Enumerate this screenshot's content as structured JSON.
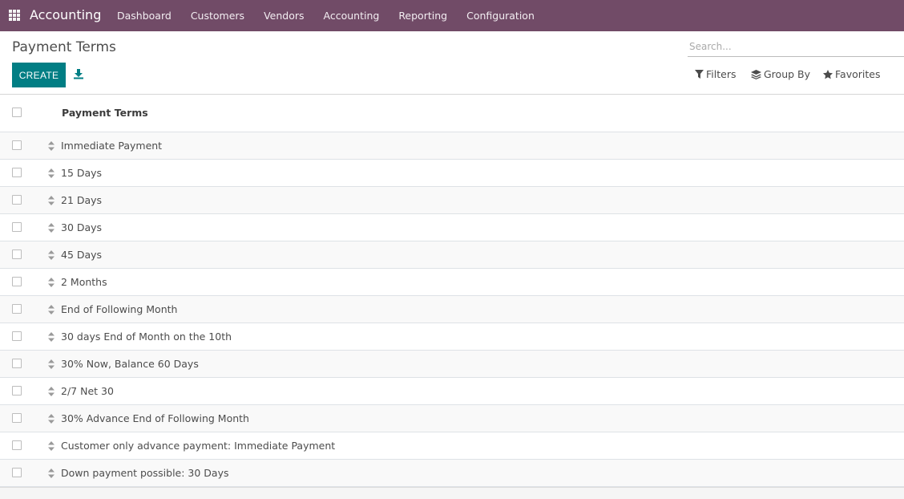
{
  "app": {
    "name": "Accounting",
    "menu": [
      "Dashboard",
      "Customers",
      "Vendors",
      "Accounting",
      "Reporting",
      "Configuration"
    ]
  },
  "control_panel": {
    "title": "Payment Terms",
    "create_label": "CREATE",
    "search_placeholder": "Search...",
    "filters_label": "Filters",
    "group_by_label": "Group By",
    "favorites_label": "Favorites"
  },
  "list": {
    "column_header": "Payment Terms",
    "rows": [
      "Immediate Payment",
      "15 Days",
      "21 Days",
      "30 Days",
      "45 Days",
      "2 Months",
      "End of Following Month",
      "30 days End of Month on the 10th",
      "30% Now, Balance 60 Days",
      "2/7 Net 30",
      "30% Advance End of Following Month",
      "Customer only advance payment: Immediate Payment",
      "Down payment possible: 30 Days"
    ]
  },
  "colors": {
    "navbar": "#714b67",
    "primary_button": "#017e84"
  }
}
